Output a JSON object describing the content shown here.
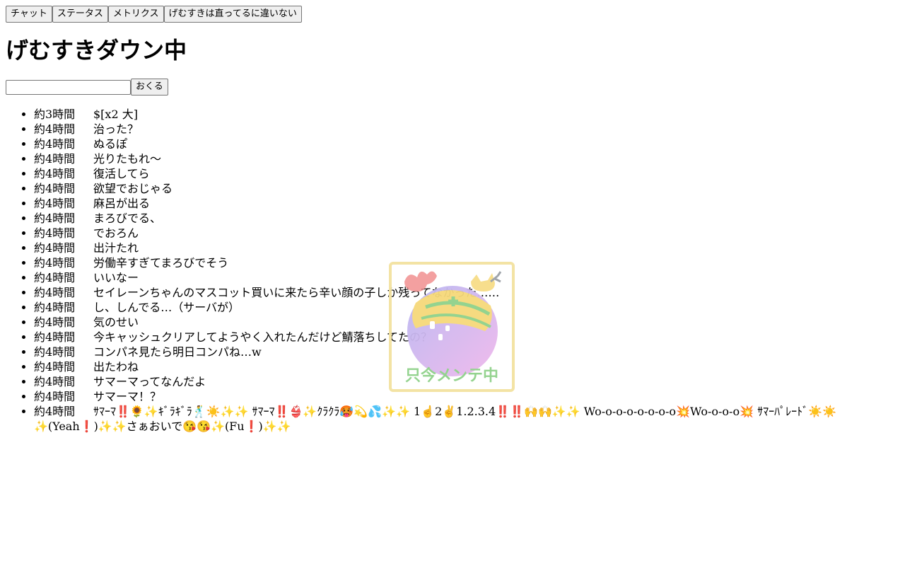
{
  "nav": {
    "chat": "チャット",
    "status": "ステータス",
    "metrics": "メトリクス",
    "fixed": "げむすきは直ってるに違いない"
  },
  "title": "げむすきダウン中",
  "send": {
    "input_value": "",
    "button_label": "おくる"
  },
  "messages": [
    {
      "time": "約3時間",
      "text": "$[x2 大]"
    },
    {
      "time": "約4時間",
      "text": "治った？"
    },
    {
      "time": "約4時間",
      "text": "ぬるぽ"
    },
    {
      "time": "約4時間",
      "text": "光りたもれ～"
    },
    {
      "time": "約4時間",
      "text": "復活してら"
    },
    {
      "time": "約4時間",
      "text": "欲望でおじゃる"
    },
    {
      "time": "約4時間",
      "text": "麻呂が出る"
    },
    {
      "time": "約4時間",
      "text": "まろびでる、"
    },
    {
      "time": "約4時間",
      "text": "でおろん"
    },
    {
      "time": "約4時間",
      "text": "出汁たれ"
    },
    {
      "time": "約4時間",
      "text": "労働辛すぎてまろびでそう"
    },
    {
      "time": "約4時間",
      "text": "いいなー"
    },
    {
      "time": "約4時間",
      "text": "セイレーンちゃんのマスコット買いに来たら辛い顔の子しか残ってなかった……"
    },
    {
      "time": "約4時間",
      "text": "し、しんでる…（サーバが）"
    },
    {
      "time": "約4時間",
      "text": "気のせい"
    },
    {
      "time": "約4時間",
      "text": "今キャッシュクリアしてようやく入れたんだけど鯖落ちしてたの？"
    },
    {
      "time": "約4時間",
      "text": "コンパネ見たら明日コンパね…w"
    },
    {
      "time": "約4時間",
      "text": "出たわね"
    },
    {
      "time": "約4時間",
      "text": "サマーマってなんだよ"
    },
    {
      "time": "約4時間",
      "text": "サマーマ！？"
    },
    {
      "time": "約4時間",
      "text": "ｻﾏｰﾏ‼️🌻✨ｷﾞﾗｷﾞﾗ🕺☀️✨✨ ｻﾏｰﾏ‼️👙✨ｸﾗｸﾗ🥵💫💦✨✨ 1☝️2✌️1.2.3.4‼️‼️🙌🙌✨✨ Wo-o-o-o-o-o-o-o💥Wo-o-o-o💥 ｻﾏｰﾊﾟﾚｰﾄﾞ☀️☀️✨(Yeah❗️)✨✨さぁおいで😘😘✨(Fu❗️)✨✨"
    }
  ],
  "mascot": {
    "caption": "只今メンテ中",
    "colors": {
      "frame": "#f3e2a0",
      "body_start": "#b9b8f2",
      "body_end": "#f0b8ec",
      "bun": "#f6d97a",
      "band": "#8fd18a",
      "lobster": "#f08a8a",
      "caption": "#8fd18a"
    }
  }
}
